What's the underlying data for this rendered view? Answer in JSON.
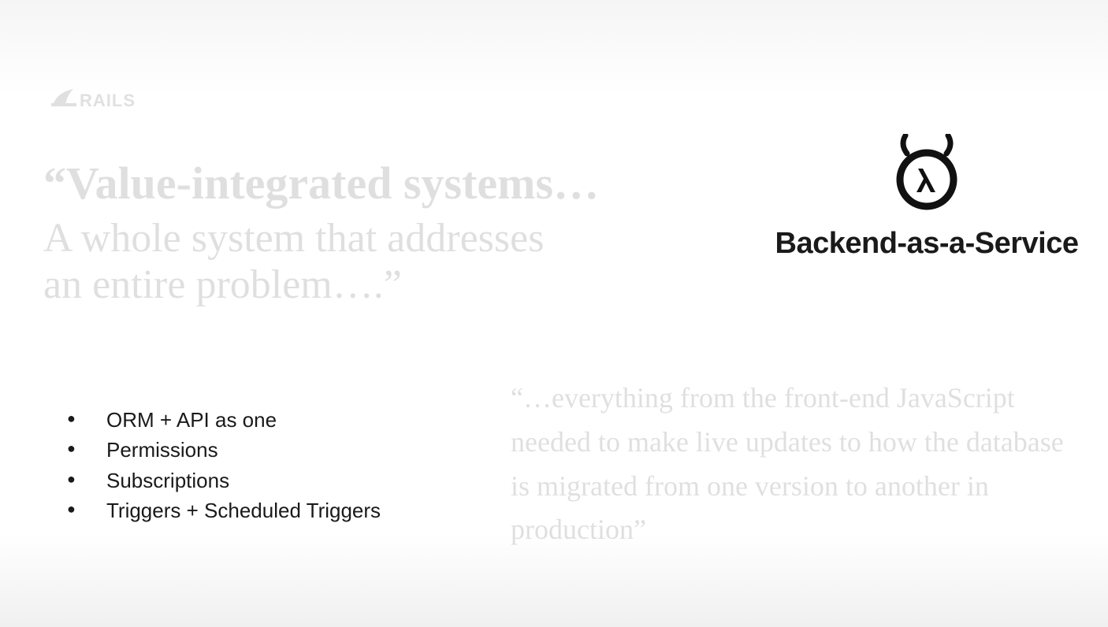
{
  "logo": {
    "text": "RAILS"
  },
  "main_quote": {
    "open_q": "“",
    "title": "Value-integrated systems",
    "title_trail": "…",
    "body_line1": "A whole system that addresses",
    "body_line2": "an entire problem….”"
  },
  "baas": {
    "title": "Backend-as-a-Service"
  },
  "bullets": {
    "items": [
      "ORM + API as one",
      "Permissions",
      "Subscriptions",
      "Triggers + Scheduled Triggers"
    ]
  },
  "side_quote": {
    "text": "“…everything from the front-end JavaScript needed to make live updates to how the database is migrated from one version to another in production”"
  }
}
